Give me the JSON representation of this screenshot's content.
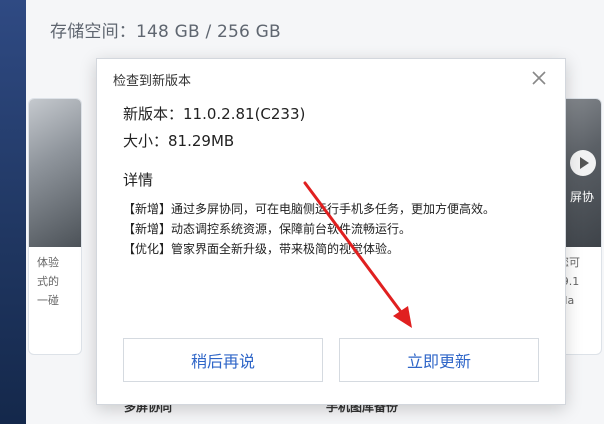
{
  "storage": {
    "label": "存储空间：148 GB / 256 GB"
  },
  "dialog": {
    "title": "检查到新版本",
    "version_line": "新版本：11.0.2.81(C233)",
    "size_line": "大小：81.29MB",
    "details_heading": "详情",
    "notes": [
      "【新增】通过多屏协同，可在电脑侧运行手机多任务，更加方便高效。",
      "【新增】动态调控系统资源，保障前台软件流畅运行。",
      "【优化】管家界面全新升级，带来极简的视觉体验。"
    ],
    "later_button": "稍后再说",
    "update_button": "立即更新"
  },
  "background": {
    "left_card_lines": [
      "体验",
      "式的",
      "一碰"
    ],
    "right_card_caption": "屏协",
    "right_card_lines": [
      "，您可",
      "UI 9.1",
      "，Ma"
    ],
    "bottom_left": "多屏协同",
    "bottom_right": "手机图库备份"
  },
  "colors": {
    "accent": "#2f66c8",
    "annotation_arrow": "#e02020"
  }
}
